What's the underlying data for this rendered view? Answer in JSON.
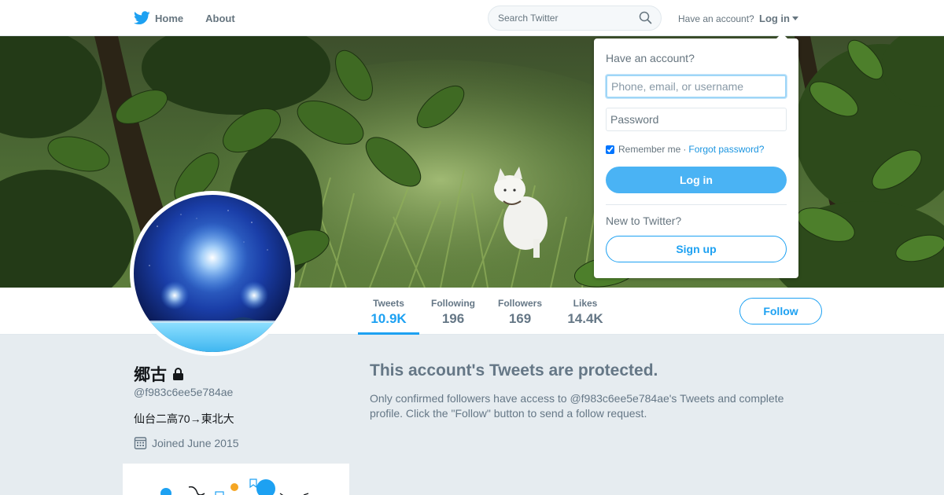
{
  "nav": {
    "home_label": "Home",
    "about_label": "About",
    "search_placeholder": "Search Twitter",
    "have_account_text": "Have an account?",
    "login_label": "Log in"
  },
  "profile": {
    "name": "郷古",
    "handle": "@f983c6ee5e784ae",
    "bio": "仙台二高70→東北大",
    "joined": "Joined June 2015",
    "follow_label": "Follow"
  },
  "stats": [
    {
      "label": "Tweets",
      "value": "10.9K",
      "active": true
    },
    {
      "label": "Following",
      "value": "196",
      "active": false
    },
    {
      "label": "Followers",
      "value": "169",
      "active": false
    },
    {
      "label": "Likes",
      "value": "14.4K",
      "active": false
    }
  ],
  "protected": {
    "title": "This account's Tweets are protected.",
    "text": "Only confirmed followers have access to @f983c6ee5e784ae's Tweets and complete profile. Click the \"Follow\" button to send a follow request."
  },
  "login_dropdown": {
    "heading": "Have an account?",
    "username_placeholder": "Phone, email, or username",
    "password_placeholder": "Password",
    "remember_me": "Remember me",
    "separator": "·",
    "forgot_password": "Forgot password?",
    "login_button": "Log in",
    "new_to_twitter": "New to Twitter?",
    "signup_button": "Sign up"
  },
  "colors": {
    "accent": "#1da1f2",
    "secondary_text": "#657786",
    "background": "#e6ecf0"
  },
  "icons": [
    "twitter-bird-icon",
    "search-icon",
    "caret-down-icon",
    "lock-icon",
    "calendar-icon"
  ]
}
